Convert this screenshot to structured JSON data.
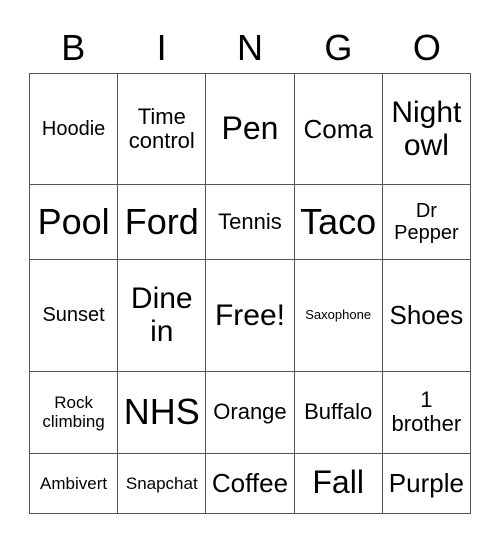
{
  "header": [
    "B",
    "I",
    "N",
    "G",
    "O"
  ],
  "rows": [
    [
      {
        "text": "Hoodie",
        "size": "s-s"
      },
      {
        "text": "Time control",
        "size": "s-sm"
      },
      {
        "text": "Pen",
        "size": "s-l"
      },
      {
        "text": "Coma",
        "size": "s-m"
      },
      {
        "text": "Night owl",
        "size": "s-ml"
      }
    ],
    [
      {
        "text": "Pool",
        "size": "s-xl"
      },
      {
        "text": "Ford",
        "size": "s-xl"
      },
      {
        "text": "Tennis",
        "size": "s-sm"
      },
      {
        "text": "Taco",
        "size": "s-xl"
      },
      {
        "text": "Dr Pepper",
        "size": "s-s"
      }
    ],
    [
      {
        "text": "Sunset",
        "size": "s-s"
      },
      {
        "text": "Dine in",
        "size": "s-ml"
      },
      {
        "text": "Free!",
        "size": "s-ml"
      },
      {
        "text": "Saxophone",
        "size": "s-xxs"
      },
      {
        "text": "Shoes",
        "size": "s-m"
      }
    ],
    [
      {
        "text": "Rock climbing",
        "size": "s-xs"
      },
      {
        "text": "NHS",
        "size": "s-xl"
      },
      {
        "text": "Orange",
        "size": "s-sm"
      },
      {
        "text": "Buffalo",
        "size": "s-sm"
      },
      {
        "text": "1 brother",
        "size": "s-sm"
      }
    ],
    [
      {
        "text": "Ambivert",
        "size": "s-xs"
      },
      {
        "text": "Snapchat",
        "size": "s-xs"
      },
      {
        "text": "Coffee",
        "size": "s-m"
      },
      {
        "text": "Fall",
        "size": "s-l"
      },
      {
        "text": "Purple",
        "size": "s-m"
      }
    ]
  ]
}
